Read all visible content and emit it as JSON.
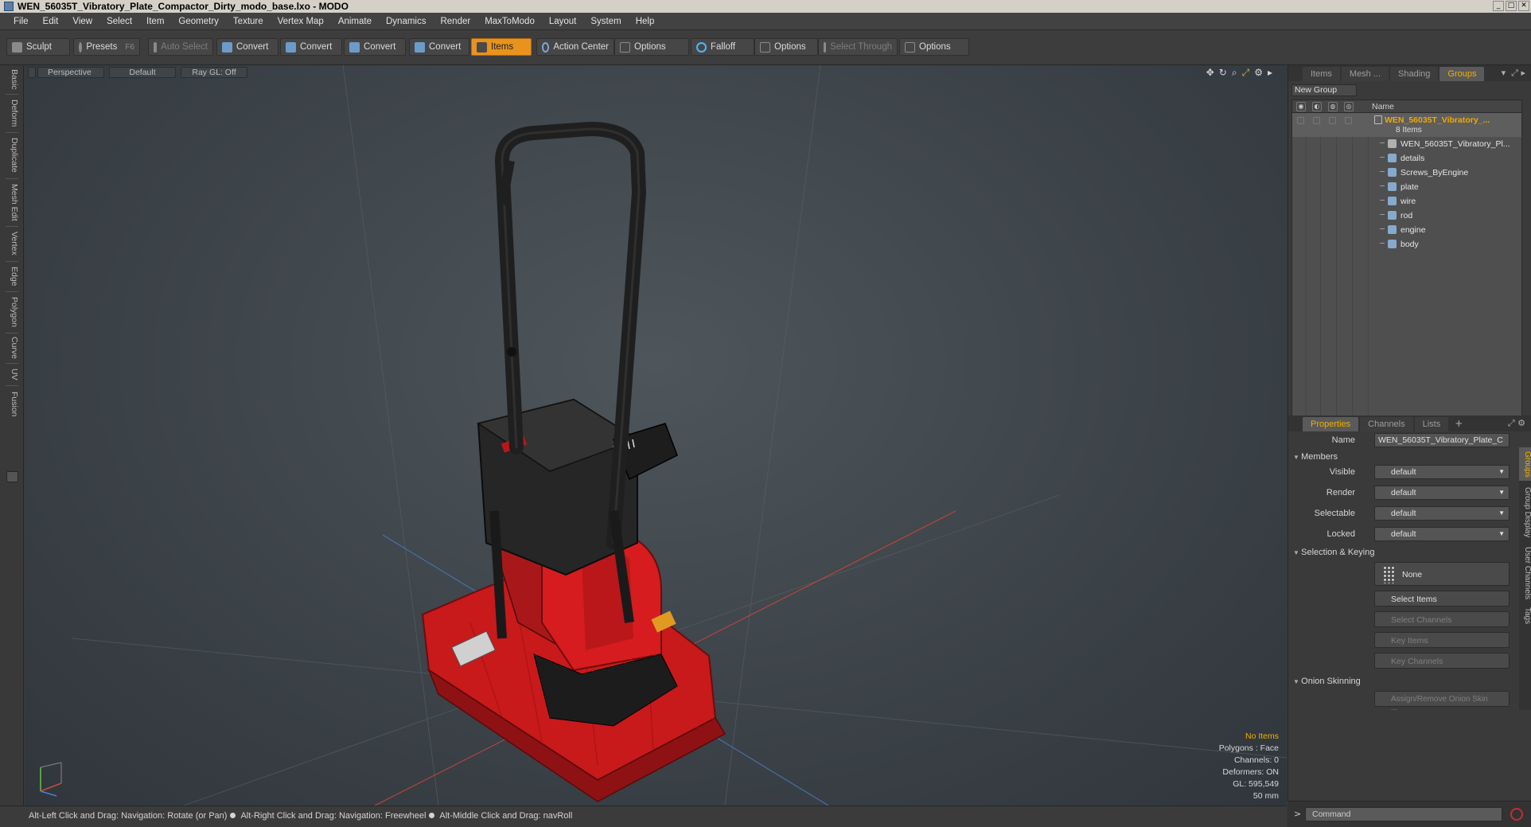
{
  "window": {
    "title": "WEN_56035T_Vibratory_Plate_Compactor_Dirty_modo_base.lxo - MODO"
  },
  "menu": [
    "File",
    "Edit",
    "View",
    "Select",
    "Item",
    "Geometry",
    "Texture",
    "Vertex Map",
    "Animate",
    "Dynamics",
    "Render",
    "MaxToModo",
    "Layout",
    "System",
    "Help"
  ],
  "toolbar": {
    "sculpt": "Sculpt",
    "presets": "Presets",
    "presets_key": "F6",
    "auto_select": "Auto Select",
    "convert1": "Convert",
    "convert2": "Convert",
    "convert3": "Convert",
    "convert4": "Convert",
    "items": "Items",
    "action_center": "Action Center",
    "options1": "Options",
    "falloff": "Falloff",
    "options2": "Options",
    "select_through": "Select Through",
    "options3": "Options"
  },
  "left_tabs": [
    "Basic",
    "Deform",
    "Duplicate",
    "Mesh Edit",
    "Vertex",
    "Edge",
    "Polygon",
    "Curve",
    "UV",
    "Fusion"
  ],
  "viewport": {
    "view": "Perspective",
    "shading": "Default",
    "raygl": "Ray GL: Off",
    "stats": {
      "items": "No Items",
      "polygons": "Polygons : Face",
      "channels": "Channels: 0",
      "deformers": "Deformers: ON",
      "gl": "GL: 595,549",
      "scale": "50 mm"
    }
  },
  "statusbar": {
    "hint1": "Alt-Left Click and Drag: Navigation: Rotate (or Pan)",
    "hint2": "Alt-Right Click and Drag: Navigation: Freewheel",
    "hint3": "Alt-Middle Click and Drag: navRoll"
  },
  "top_panel": {
    "tabs": [
      "Items",
      "Mesh ...",
      "Shading",
      "Groups"
    ],
    "active_tab": "Groups",
    "new_group": "New Group",
    "column_name": "Name",
    "group": {
      "name": "WEN_56035T_Vibratory_...",
      "count": "8 Items"
    },
    "items": [
      "WEN_56035T_Vibratory_Pl...",
      "details",
      "Screws_ByEngine",
      "plate",
      "wire",
      "rod",
      "engine",
      "body"
    ]
  },
  "properties": {
    "tabs": [
      "Properties",
      "Channels",
      "Lists"
    ],
    "name_label": "Name",
    "name_value": "WEN_56035T_Vibratory_Plate_C",
    "members_section": "Members",
    "fields": [
      {
        "label": "Visible",
        "value": "default"
      },
      {
        "label": "Render",
        "value": "default"
      },
      {
        "label": "Selectable",
        "value": "default"
      },
      {
        "label": "Locked",
        "value": "default"
      }
    ],
    "selection_section": "Selection & Keying",
    "none_btn": "None",
    "select_items": "Select Items",
    "select_channels": "Select Channels",
    "key_items": "Key Items",
    "key_channels": "Key Channels",
    "onion_section": "Onion Skinning",
    "onion_btn": "Assign/Remove Onion Skin ...",
    "side_tabs": [
      "Groups",
      "Group Display",
      "User Channels",
      "Tags"
    ]
  },
  "command": {
    "placeholder": "Command"
  },
  "colors": {
    "accent": "#e9931f",
    "selected_text": "#f0a800",
    "model_red": "#d8191c"
  }
}
